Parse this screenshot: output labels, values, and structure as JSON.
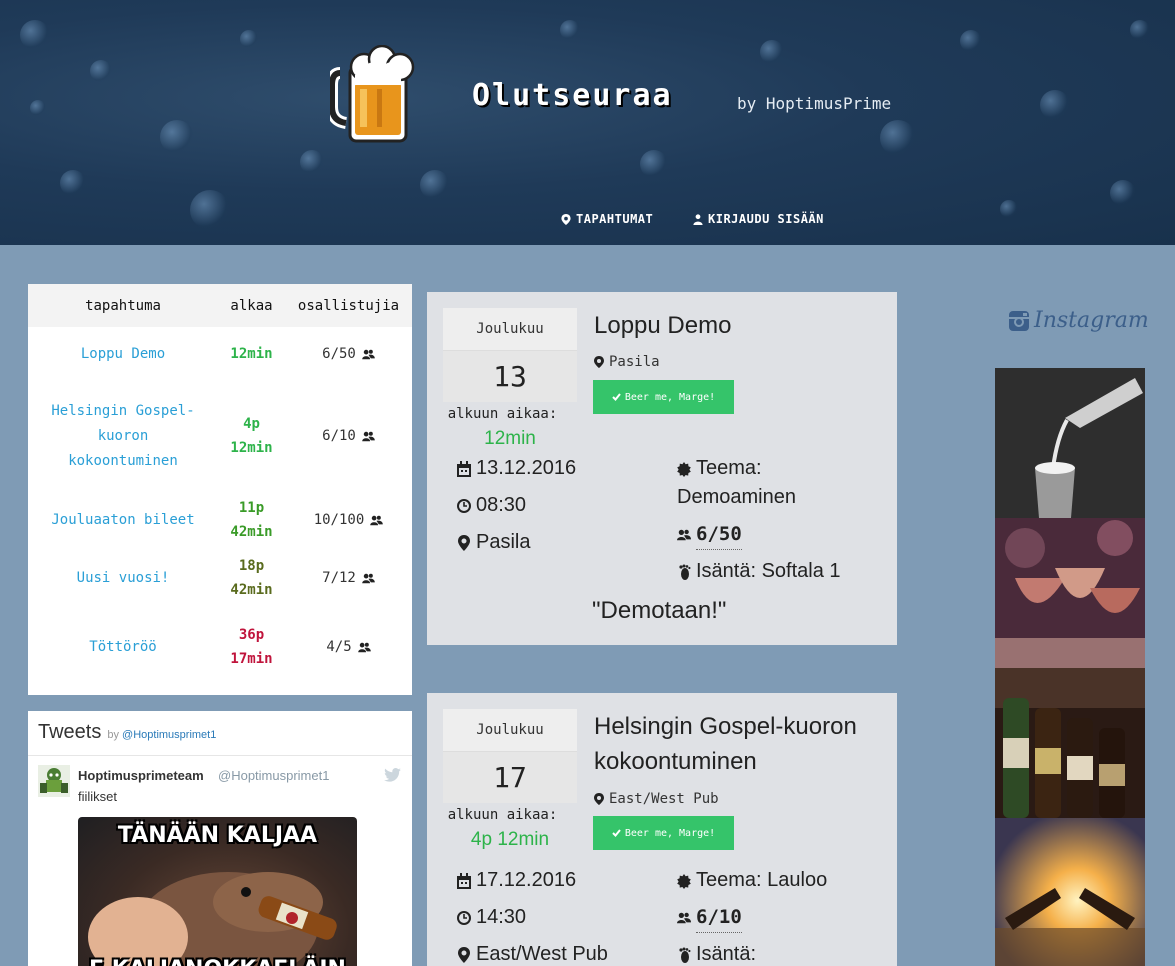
{
  "header": {
    "site_title": "Olutseuraa",
    "byline": "by HoptimusPrime",
    "nav": [
      {
        "label": "TAPAHTUMAT",
        "icon": "map-marker-icon"
      },
      {
        "label": "KIRJAUDU SISÄÄN",
        "icon": "user-icon"
      }
    ]
  },
  "events_table": {
    "headers": [
      "tapahtuma",
      "alkaa",
      "osallistujia"
    ],
    "rows": [
      {
        "name_lines": [
          "Loppu Demo"
        ],
        "time_lines": [
          "12min"
        ],
        "time_color": "#2db34a",
        "count": "6/50"
      },
      {
        "name_lines": [
          "Helsingin Gospel-",
          "kuoron",
          "kokoontuminen"
        ],
        "time_lines": [
          "4p",
          "12min"
        ],
        "time_color": "#2db34a",
        "count": "6/10"
      },
      {
        "name_lines": [
          "Jouluaaton bileet"
        ],
        "time_lines": [
          "11p",
          "42min"
        ],
        "time_color": "#3a9b28",
        "count": "10/100"
      },
      {
        "name_lines": [
          "Uusi vuosi!"
        ],
        "time_lines": [
          "18p",
          "42min"
        ],
        "time_color": "#5a6b1e",
        "count": "7/12"
      },
      {
        "name_lines": [
          "Töttöröö"
        ],
        "time_lines": [
          "36p",
          "17min"
        ],
        "time_color": "#c0143c",
        "count": "4/5"
      }
    ]
  },
  "tweets": {
    "title": "Tweets",
    "by": "by",
    "account_link": "@Hoptimusprimet1",
    "tweet": {
      "name": "Hoptimusprimeteam",
      "handle": "@Hoptimusprimet1",
      "text": "fiilikset",
      "meme_top": "TÄNÄÄN KALJAA",
      "meme_bottom": "E KALJANOKKAELÄIN"
    }
  },
  "event_cards": [
    {
      "month": "Joulukuu",
      "day": "13",
      "until_label": "alkuun aikaa:",
      "until_value": "12min",
      "title_lines": [
        "Loppu Demo"
      ],
      "location": "Pasila",
      "button": "Beer me, Marge!",
      "date": "13.12.2016",
      "time": "08:30",
      "place": "Pasila",
      "theme_label": "Teema:",
      "theme_value": "Demoaminen",
      "participants": "6/50",
      "host": "Isäntä: Softala 1",
      "quote": "\"Demotaan!\""
    },
    {
      "month": "Joulukuu",
      "day": "17",
      "until_label": "alkuun aikaa:",
      "until_value": "4p 12min",
      "title_lines": [
        "Helsingin Gospel-kuoron",
        "kokoontuminen"
      ],
      "location": "East/West Pub",
      "button": "Beer me, Marge!",
      "date": "17.12.2016",
      "time": "14:30",
      "place": "East/West Pub",
      "theme": "Teema: Lauloo",
      "participants": "6/10",
      "host": "Isäntä:"
    }
  ],
  "instagram": {
    "logo_text": "Instagram"
  }
}
